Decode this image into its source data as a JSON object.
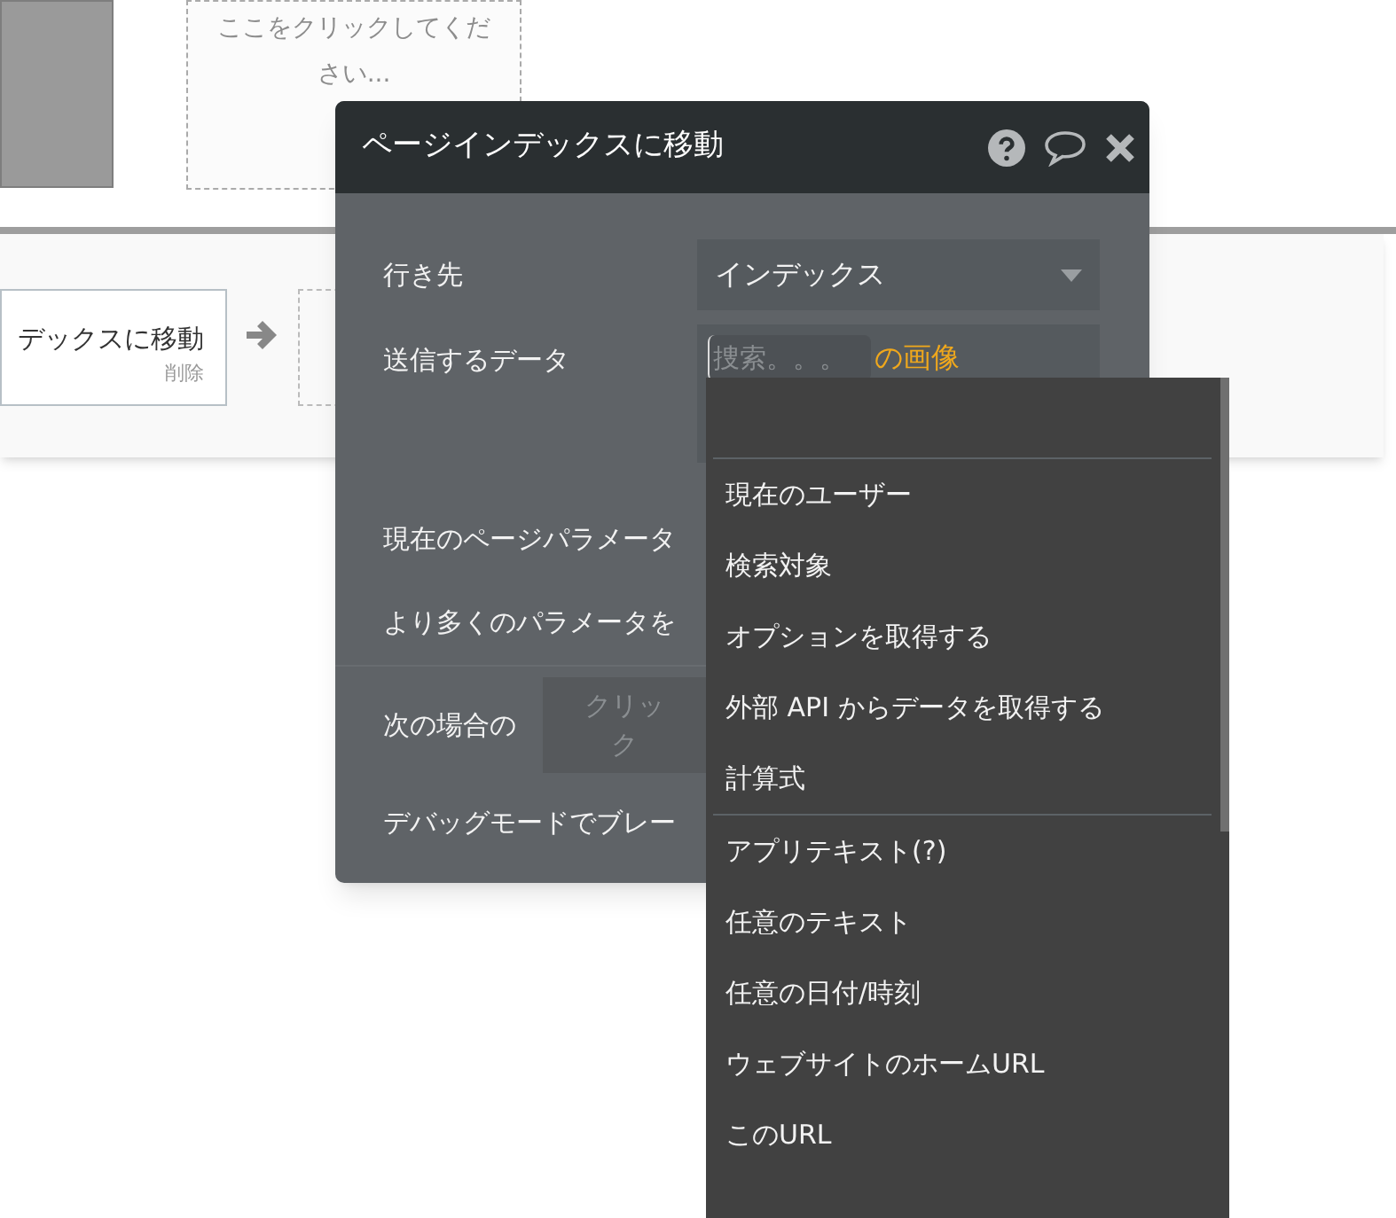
{
  "canvas": {
    "placeholder_text": "ここをクリックしてください...",
    "action_card": {
      "title": "デックスに移動",
      "delete_link": "削除"
    }
  },
  "dialog": {
    "title": "ページインデックスに移動",
    "fields": [
      {
        "kind": "select",
        "label": "行き先",
        "value": "インデックス"
      },
      {
        "kind": "data",
        "label": "送信するデータ",
        "placeholder": "捜索。。。",
        "suffix": "の画像"
      },
      {
        "kind": "text",
        "label": "現在のページパラメータ"
      },
      {
        "kind": "text",
        "label": "より多くのパラメータを"
      },
      {
        "kind": "condition",
        "label": "次の場合の",
        "placeholder": "クリック"
      },
      {
        "kind": "text",
        "label": "デバッグモードでブレー"
      }
    ]
  },
  "dropdown": {
    "groups": [
      [
        "現在のユーザー",
        "検索対象",
        "オプションを取得する",
        "外部 API からデータを取得する",
        "計算式"
      ],
      [
        "アプリテキスト(?)",
        "任意のテキスト",
        "任意の日付/時刻",
        "ウェブサイトのホームURL",
        "このURL"
      ]
    ]
  }
}
